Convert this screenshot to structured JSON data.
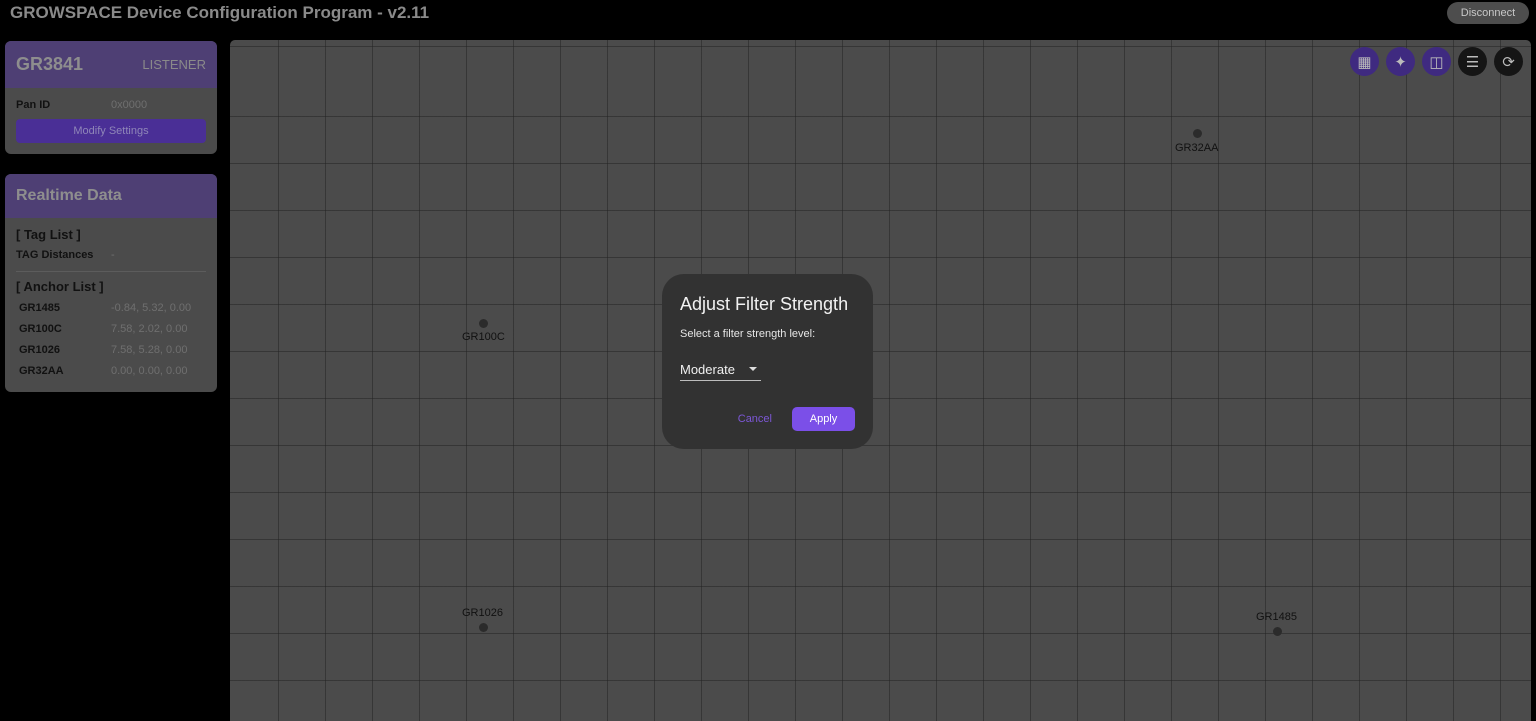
{
  "header": {
    "title": "GROWSPACE Device Configuration Program - v2.11",
    "disconnect_label": "Disconnect"
  },
  "device_card": {
    "device_id": "GR3841",
    "role": "LISTENER",
    "pan_id_label": "Pan ID",
    "pan_id_value": "0x0000",
    "modify_label": "Modify Settings"
  },
  "realtime": {
    "title": "Realtime Data",
    "tag_list_label": "[ Tag List ]",
    "tag_distances_label": "TAG Distances",
    "tag_distances_value": "-",
    "anchor_list_label": "[ Anchor List ]",
    "anchors": [
      {
        "name": "GR1485",
        "coords": "-0.84, 5.32, 0.00"
      },
      {
        "name": "GR100C",
        "coords": "7.58, 2.02, 0.00"
      },
      {
        "name": "GR1026",
        "coords": "7.58, 5.28, 0.00"
      },
      {
        "name": "GR32AA",
        "coords": "0.00, 0.00, 0.00"
      }
    ]
  },
  "map": {
    "toolbar": [
      {
        "name": "grid-icon",
        "glyph": "▦"
      },
      {
        "name": "magic-wand-icon",
        "glyph": "✦"
      },
      {
        "name": "compare-icon",
        "glyph": "◫"
      },
      {
        "name": "tune-icon",
        "glyph": "☰"
      },
      {
        "name": "refresh-icon",
        "glyph": "⟳"
      }
    ],
    "anchors": [
      {
        "label": "GR32AA"
      },
      {
        "label": "GR100C"
      },
      {
        "label": "GR1026"
      },
      {
        "label": "GR1485"
      }
    ]
  },
  "dialog": {
    "title": "Adjust Filter Strength",
    "prompt": "Select a filter strength level:",
    "selected_level": "Moderate",
    "cancel_label": "Cancel",
    "apply_label": "Apply"
  },
  "colors": {
    "accent": "#7b4fe8",
    "card_header": "#4e3f74",
    "dialog_bg": "#323232"
  }
}
